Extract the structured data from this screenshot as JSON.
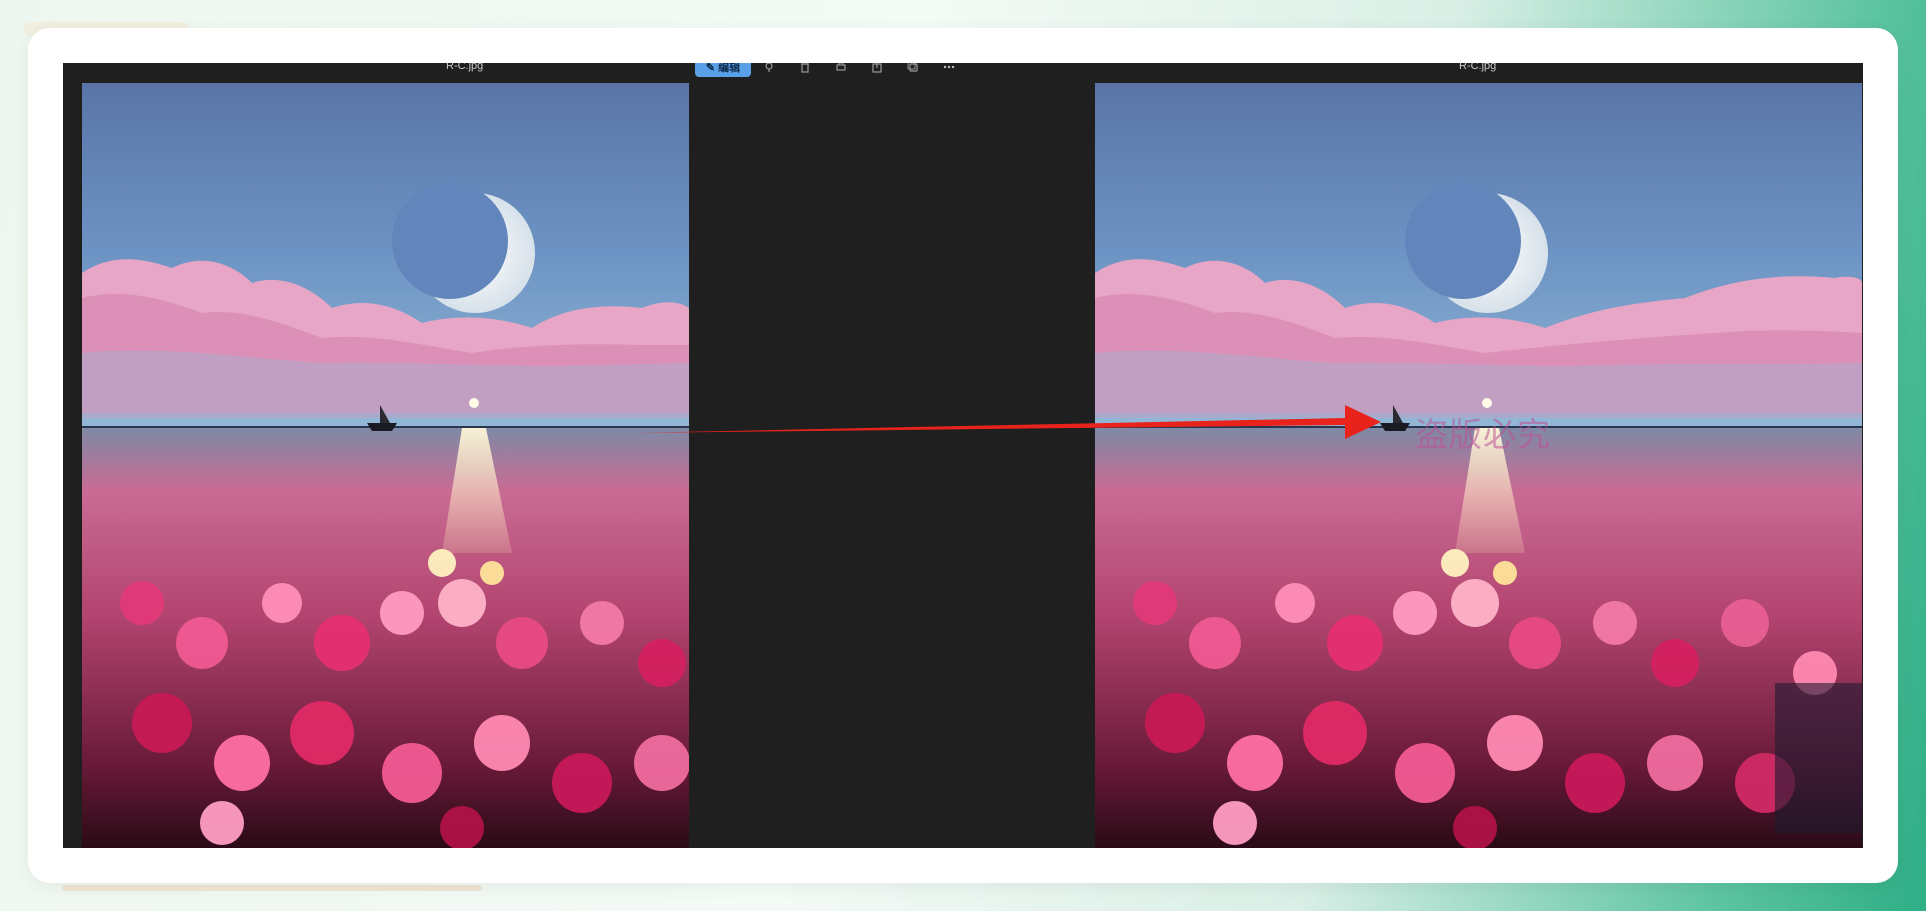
{
  "viewer": {
    "left_filename": "R-C.jpg",
    "right_filename": "R-C.jpg"
  },
  "toolbar": {
    "edit_label": "编辑",
    "edit_icon": "edit-icon",
    "buttons": [
      "adjust-icon",
      "delete-icon",
      "print-icon",
      "share-icon",
      "copy-icon",
      "more-icon"
    ]
  },
  "watermark": {
    "text": "盗版必究"
  },
  "colors": {
    "accent": "#5aa0e6",
    "arrow": "#e8231c",
    "viewer_bg": "#1f1f1f"
  }
}
